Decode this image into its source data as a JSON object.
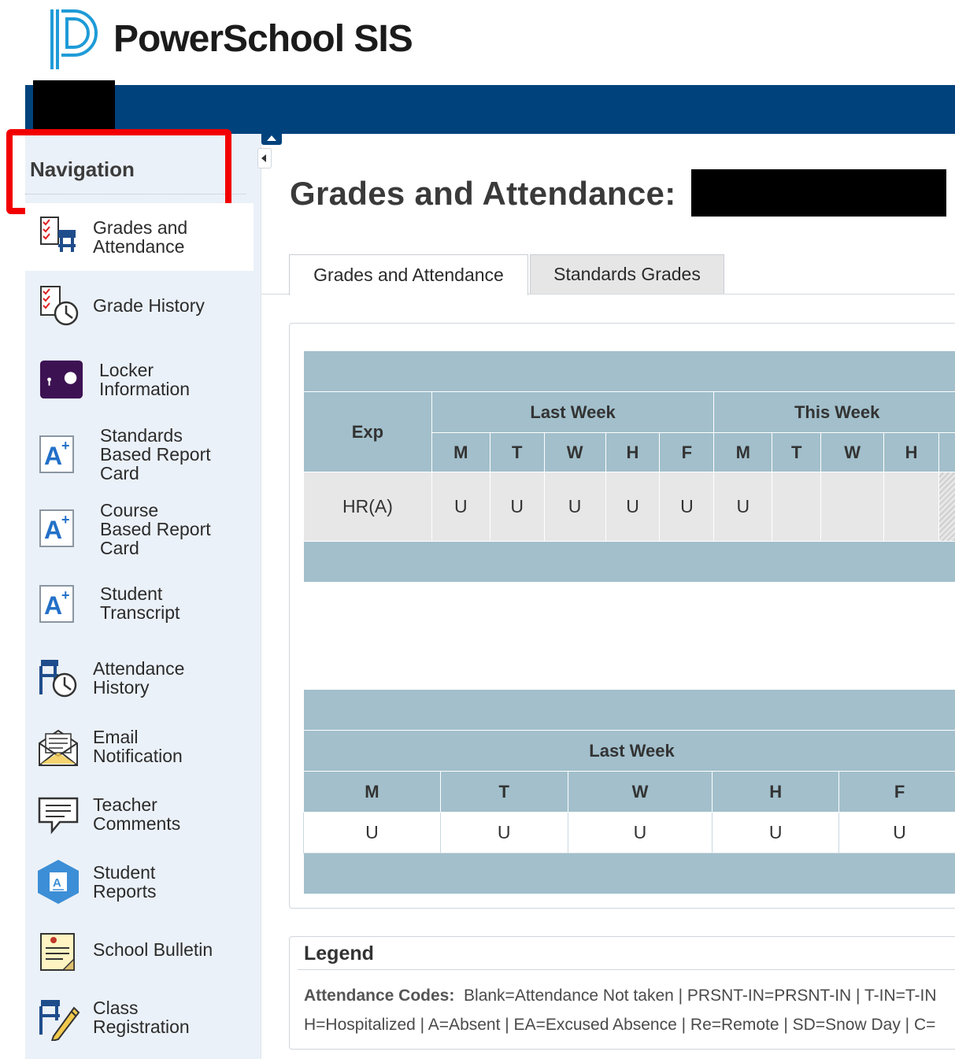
{
  "app": {
    "brand": "PowerSchool SIS"
  },
  "sidebar": {
    "header": "Navigation",
    "items": [
      {
        "label": "Grades and\nAttendance",
        "icon": "grades-attendance-icon"
      },
      {
        "label": "Grade History",
        "icon": "grade-history-icon"
      },
      {
        "label": "Locker\nInformation",
        "icon": "locker-icon"
      },
      {
        "label": "Standards\nBased Report\nCard",
        "icon": "report-card-icon"
      },
      {
        "label": "Course\nBased Report\nCard",
        "icon": "report-card-icon"
      },
      {
        "label": "Student\nTranscript",
        "icon": "transcript-icon"
      },
      {
        "label": "Attendance\nHistory",
        "icon": "attendance-history-icon"
      },
      {
        "label": "Email\nNotification",
        "icon": "email-icon"
      },
      {
        "label": "Teacher\nComments",
        "icon": "comments-icon"
      },
      {
        "label": "Student\nReports",
        "icon": "student-reports-icon"
      },
      {
        "label": "School Bulletin",
        "icon": "bulletin-icon"
      },
      {
        "label": "Class\nRegistration",
        "icon": "class-registration-icon"
      }
    ]
  },
  "main": {
    "title": "Grades and Attendance:",
    "tabs": [
      {
        "label": "Grades and Attendance",
        "active": true
      },
      {
        "label": "Standards Grades",
        "active": false
      }
    ],
    "table1": {
      "exp_header": "Exp",
      "last_week": "Last Week",
      "this_week": "This Week",
      "days_last": [
        "M",
        "T",
        "W",
        "H",
        "F"
      ],
      "days_this": [
        "M",
        "T",
        "W",
        "H"
      ],
      "row": {
        "exp": "HR(A)",
        "last": [
          "U",
          "U",
          "U",
          "U",
          "U"
        ],
        "this": [
          "U",
          "",
          "",
          ""
        ]
      }
    },
    "table2": {
      "last_week": "Last Week",
      "days": [
        "M",
        "T",
        "W",
        "H",
        "F"
      ],
      "values": [
        "U",
        "U",
        "U",
        "U",
        "U"
      ]
    }
  },
  "legend": {
    "title": "Legend",
    "codes_label": "Attendance Codes:",
    "line1": "Blank=Attendance Not taken | PRSNT-IN=PRSNT-IN | T-IN=T-IN",
    "line2": "H=Hospitalized | A=Absent | EA=Excused Absence | Re=Remote | SD=Snow Day | C="
  },
  "colors": {
    "topbar": "#00427c",
    "sidebar_bg": "#ebf1f8",
    "table_header": "#a2bfcb",
    "highlight": "#f20000"
  }
}
